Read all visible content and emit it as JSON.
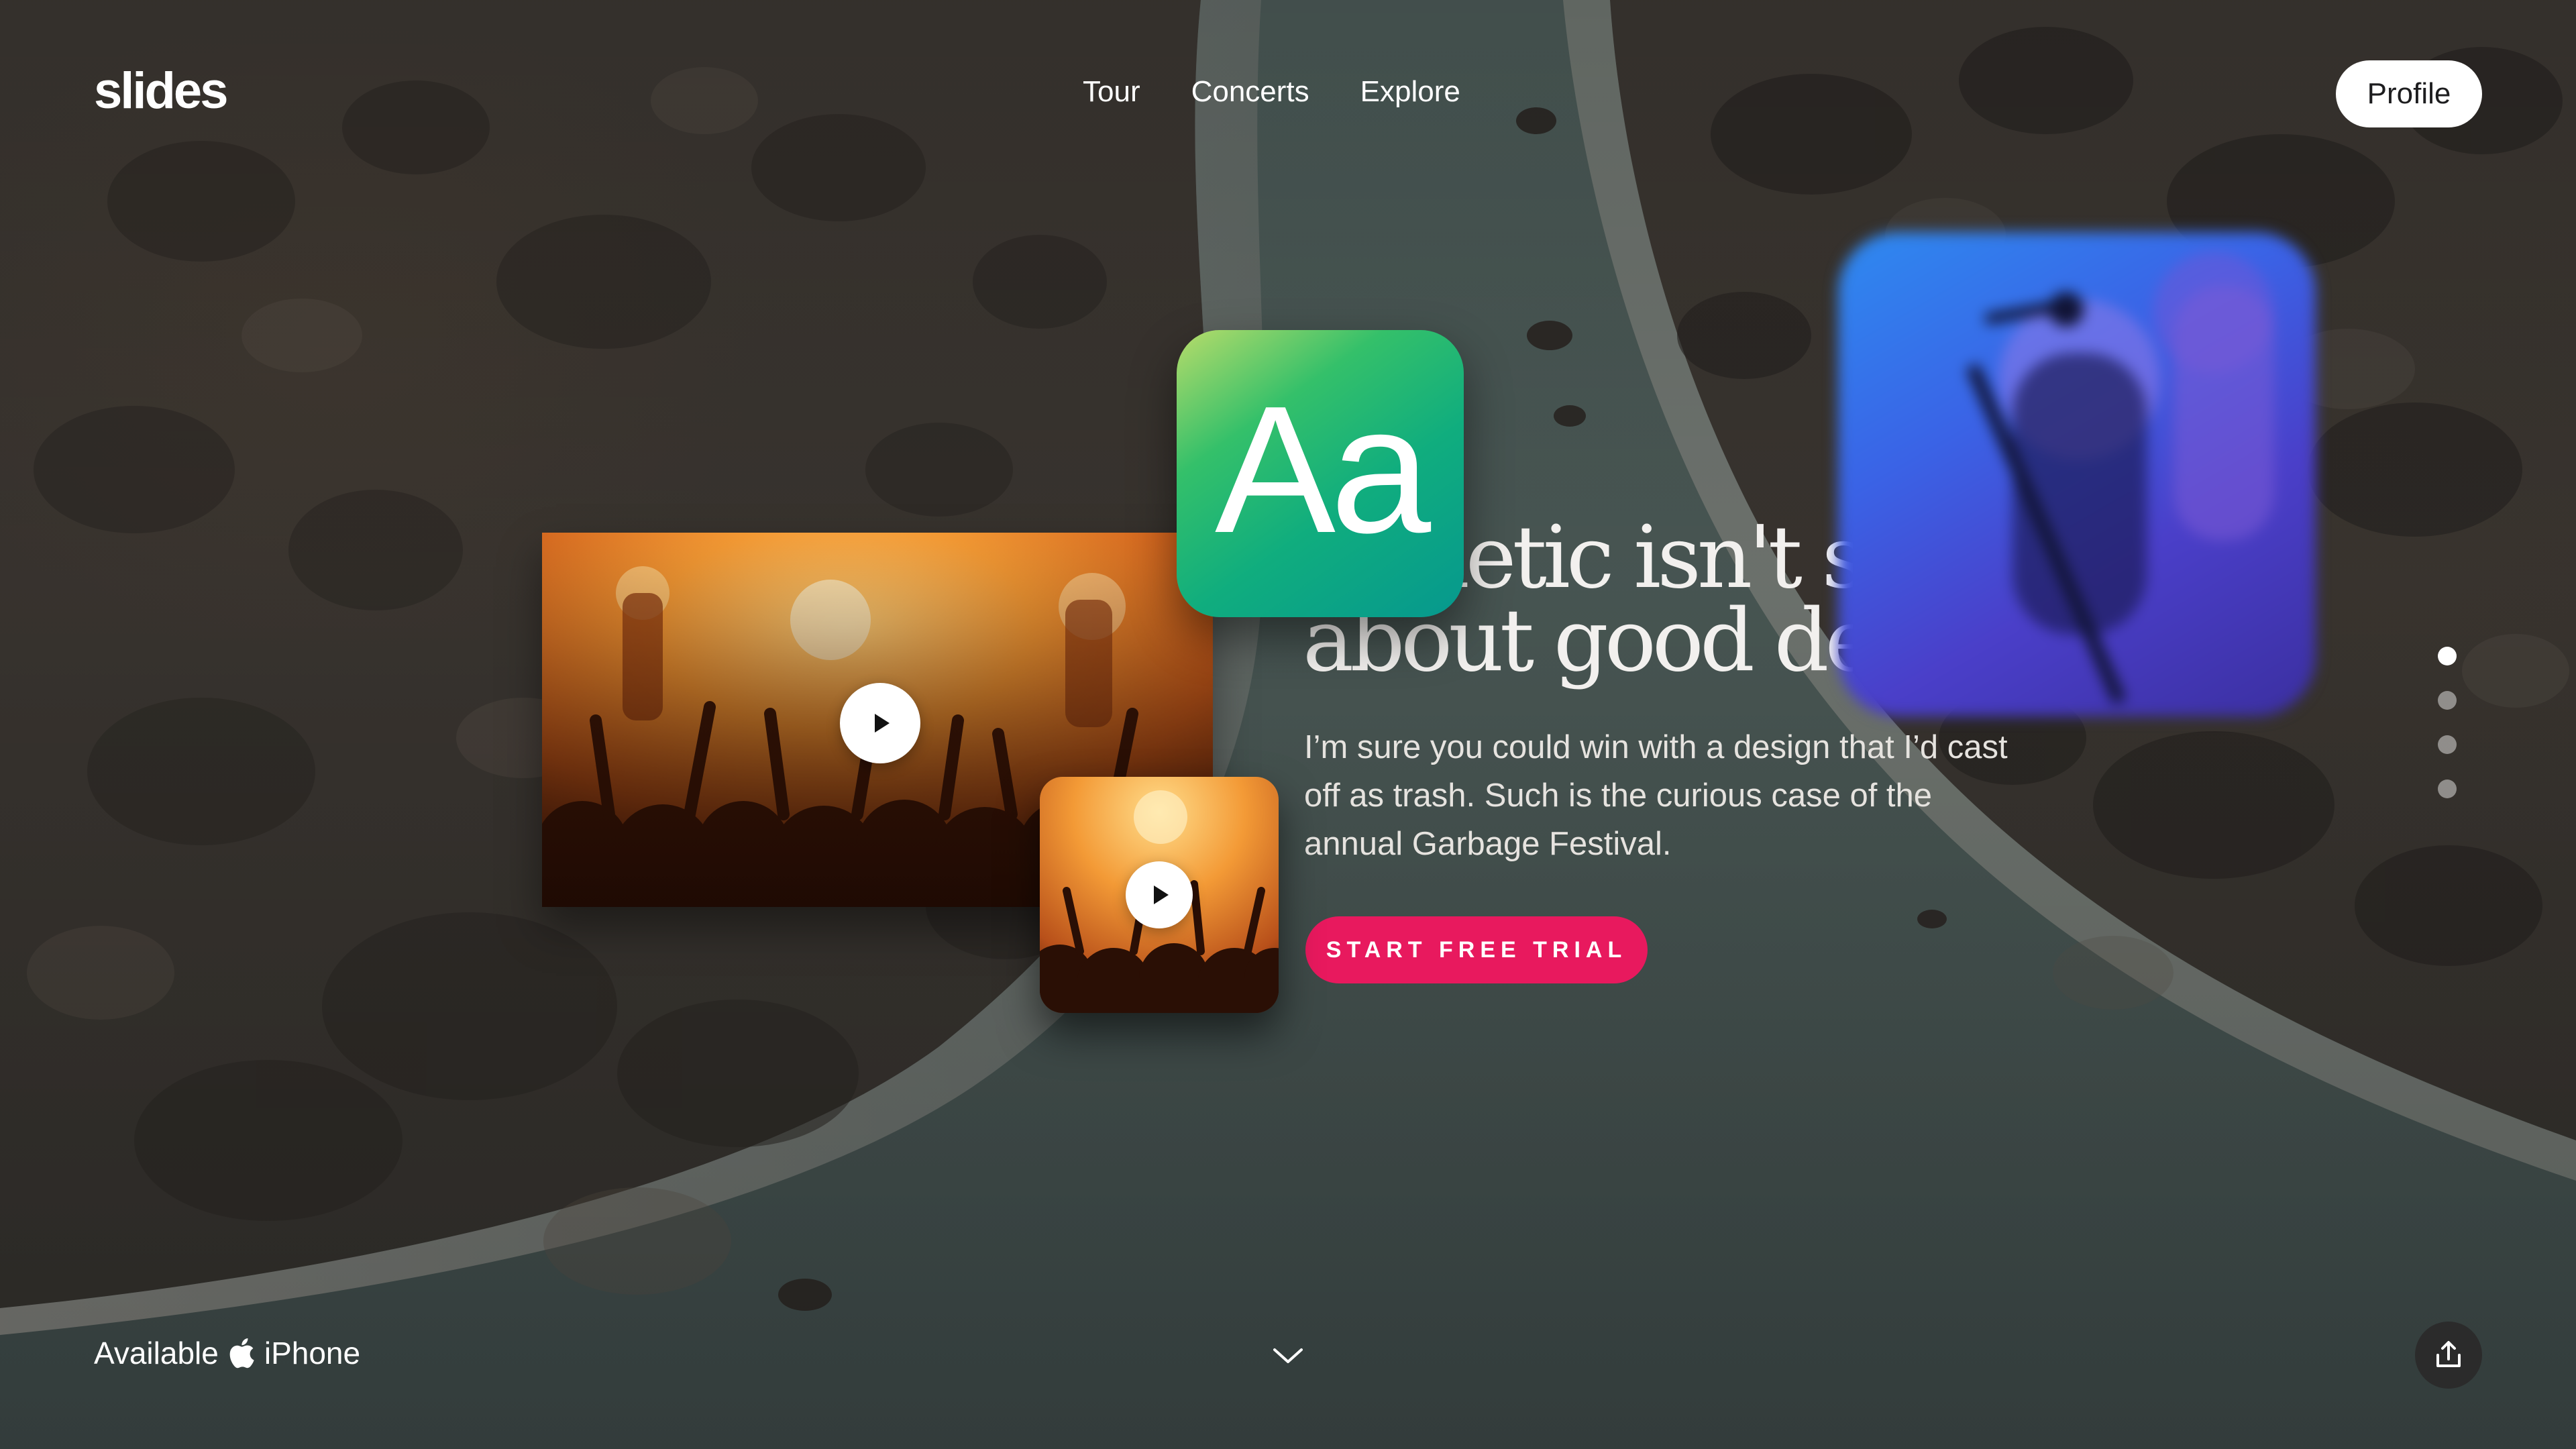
{
  "brand": {
    "logo": "slides"
  },
  "nav": {
    "items": [
      "Tour",
      "Concerts",
      "Explore"
    ]
  },
  "header": {
    "profile_label": "Profile"
  },
  "hero": {
    "headline_line1": "Aesthetic isn't simply",
    "headline_line2": "about good design",
    "body": "I’m sure you could win with a design that I’d cast off as trash. Such is the curious case of the annual Garbage Festival.",
    "cta_label": "START FREE TRIAL",
    "app_icon_text": "Aa"
  },
  "pagination": {
    "count": 4,
    "active_index": 0
  },
  "footer": {
    "available_label": "Available",
    "platform_label": "iPhone"
  },
  "colors": {
    "accent": "#e8195e",
    "app_icon_gradient": [
      "#b8dc6a",
      "#10ad7e",
      "#06988e"
    ],
    "concert_orange": "#f08a2a",
    "blur_card_blue": "#3a63e6"
  },
  "icons": {
    "play": "play-icon",
    "apple": "apple-icon",
    "chevron": "chevron-down-icon",
    "share": "share-icon"
  }
}
